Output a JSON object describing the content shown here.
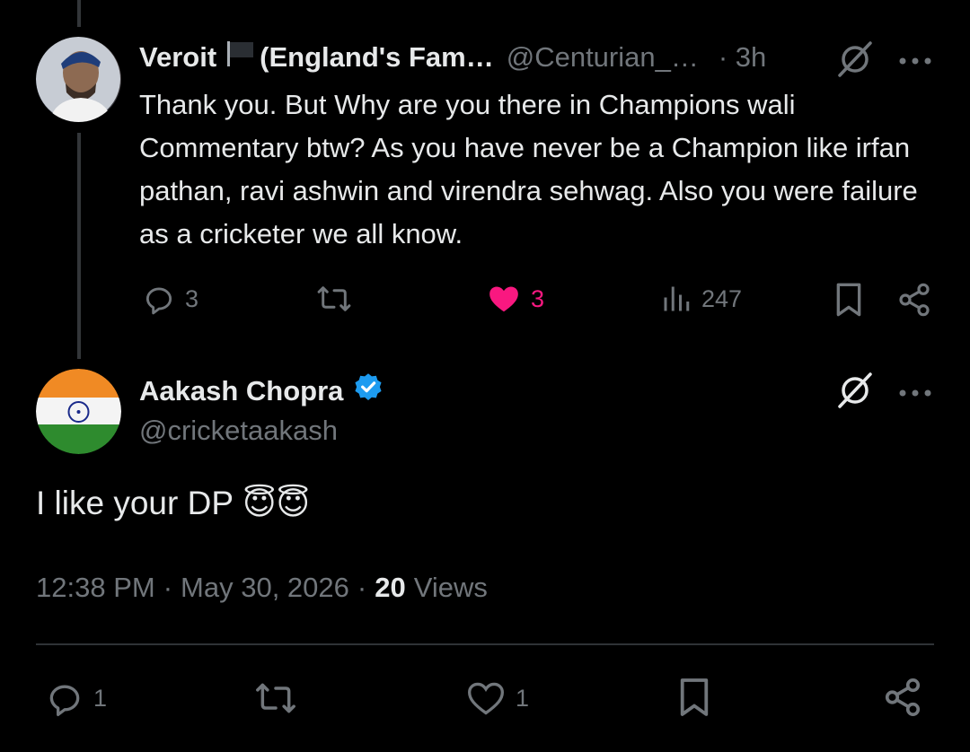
{
  "reply": {
    "display_name": "Veroit",
    "display_name_rest": "(England's Fam…",
    "handle": "@Centurian_…",
    "time": "· 3h",
    "text": "Thank you. But Why are you there in Champions wali Commentary btw? As you have never be a Champion like irfan pathan, ravi ashwin and virendra sehwag. Also you were failure as a cricketer we all know.",
    "actions": {
      "replies": "3",
      "likes": "3",
      "views": "247"
    }
  },
  "main": {
    "display_name": "Aakash Chopra",
    "handle": "@cricketaakash",
    "text": "I like your DP",
    "emojis": "😇😇",
    "time": "12:38 PM",
    "date": "May 30, 2026",
    "separator": "·",
    "views_count": "20",
    "views_label": "Views",
    "actions": {
      "replies": "1",
      "likes": "1"
    }
  },
  "colors": {
    "background": "#000000",
    "text": "#e7e9ea",
    "muted": "#71767b",
    "like_active": "#f91880",
    "verified": "#1d9bf0"
  },
  "icons": [
    "flag-icon",
    "grok-icon",
    "more-icon",
    "reply-icon",
    "retweet-icon",
    "like-icon",
    "views-icon",
    "bookmark-icon",
    "share-icon",
    "verified-icon"
  ]
}
